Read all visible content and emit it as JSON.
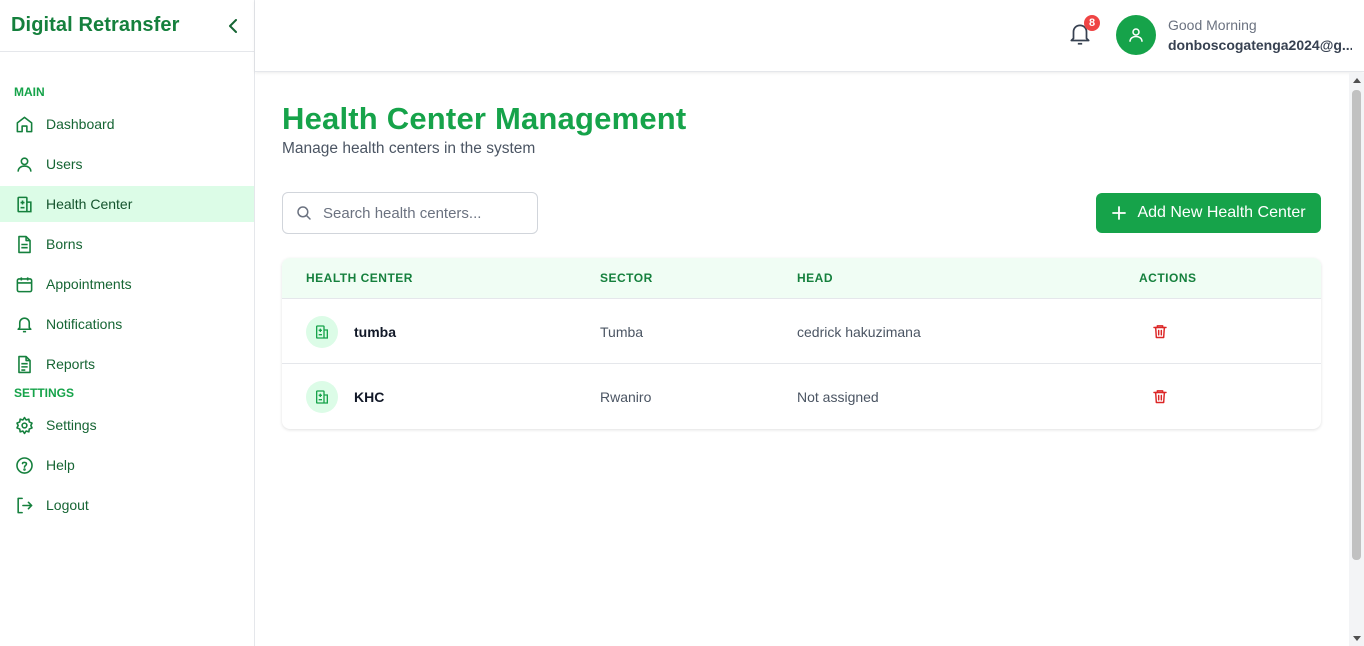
{
  "app": {
    "title": "Digital Retransfer"
  },
  "sidebar": {
    "main_label": "MAIN",
    "main_items": [
      {
        "label": "Dashboard",
        "icon": "home-icon"
      },
      {
        "label": "Users",
        "icon": "user-icon"
      },
      {
        "label": "Health Center",
        "icon": "hospital-icon",
        "active": true
      },
      {
        "label": "Borns",
        "icon": "document-icon"
      },
      {
        "label": "Appointments",
        "icon": "calendar-icon"
      },
      {
        "label": "Notifications",
        "icon": "bell-icon"
      },
      {
        "label": "Reports",
        "icon": "report-icon"
      }
    ],
    "settings_label": "SETTINGS",
    "settings_items": [
      {
        "label": "Settings",
        "icon": "gear-icon"
      },
      {
        "label": "Help",
        "icon": "help-icon"
      },
      {
        "label": "Logout",
        "icon": "logout-icon"
      }
    ]
  },
  "header": {
    "notification_count": "8",
    "greeting": "Good Morning",
    "email": "donboscogatenga2024@g..."
  },
  "main": {
    "title": "Health Center Management",
    "subtitle": "Manage health centers in the system",
    "search_placeholder": "Search health centers...",
    "add_button": "Add New Health Center",
    "columns": [
      "HEALTH CENTER",
      "SECTOR",
      "HEAD",
      "ACTIONS"
    ],
    "rows": [
      {
        "name": "tumba",
        "sector": "Tumba",
        "head": "cedrick hakuzimana"
      },
      {
        "name": "KHC",
        "sector": "Rwaniro",
        "head": "Not assigned"
      }
    ]
  },
  "colors": {
    "brand": "#16a34a",
    "active_bg": "#dcfce7",
    "danger": "#dc2626",
    "badge": "#ef4444"
  }
}
